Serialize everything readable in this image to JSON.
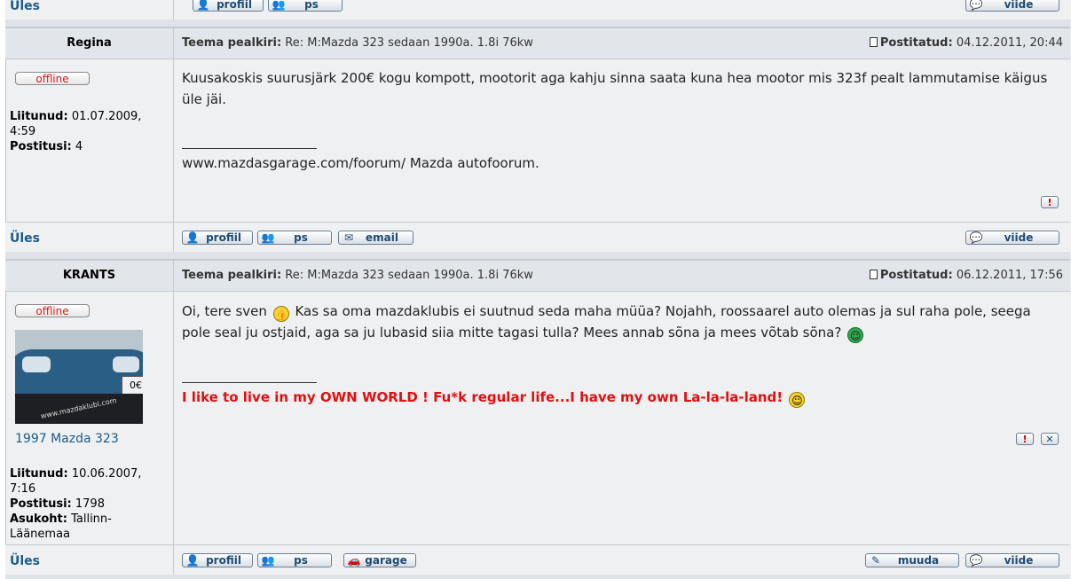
{
  "labels": {
    "up": "Üles",
    "subject": "Teema pealkiri:",
    "posted": "Postitatud:",
    "joined": "Liitunud:",
    "posts": "Postitusi:",
    "location": "Asukoht:"
  },
  "buttons": {
    "profile": "profiil",
    "pm": "ps",
    "email": "email",
    "quote": "viide",
    "edit": "muuda",
    "garage": "garage",
    "offline": "offline"
  },
  "post1": {
    "author": "Regina",
    "subject": "Re: M:Mazda 323 sedaan 1990a. 1.8i 76kw",
    "posted": "04.12.2011, 20:44",
    "joined": "01.07.2009, 4:59",
    "post_count": "4",
    "body": "Kuusakoskis suurusjärk 200€ kogu kompott, mootorit aga kahju sinna saata kuna hea mootor mis 323f pealt lammutamise käigus üle jäi.",
    "signature": "www.mazdasgarage.com/foorum/ Mazda autofoorum."
  },
  "post2": {
    "author": "KRANTS",
    "subject": "Re: M:Mazda 323 sedaan 1990a. 1.8i 76kw",
    "posted": "06.12.2011, 17:56",
    "car": "1997 Mazda 323",
    "joined": "10.06.2007, 7:16",
    "post_count": "1798",
    "location": "Tallinn-Läänemaa",
    "body_part1": "Oi, tere sven",
    "body_part2": "Kas sa oma mazdaklubis ei suutnud seda maha müüa? Nojahh, roossaarel auto olemas ja sul raha pole, seega pole seal ju ostjaid, aga sa ju lubasid siia mitte tagasi tulla? Mees annab sõna ja mees võtab sõna?",
    "signature": "I like to live in my OWN WORLD ! Fu*k regular life...I have my own La-la-la-land!",
    "avatar_text": "www.mazdaklubi.com"
  },
  "colors": {
    "link": "#1e5a86",
    "signature_red": "#e01010",
    "offline_red": "#d42020"
  }
}
